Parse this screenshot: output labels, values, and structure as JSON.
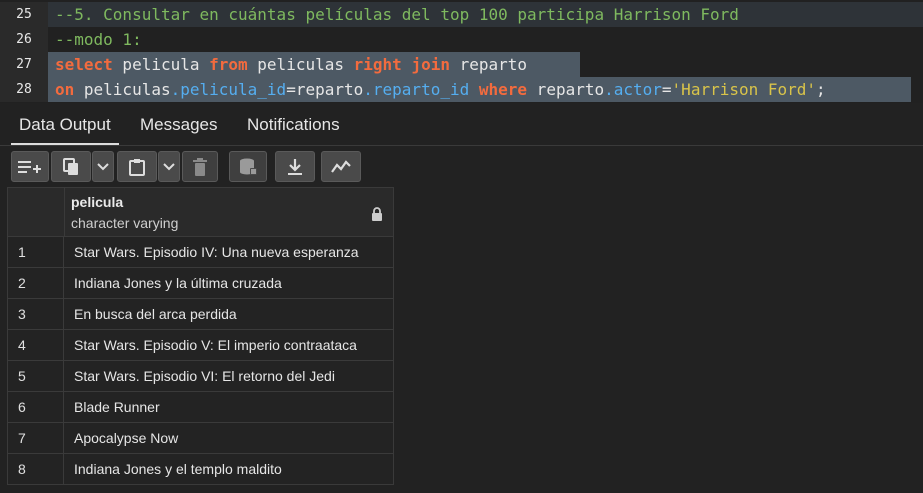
{
  "editor": {
    "lines": [
      {
        "num": "25",
        "tokens": [
          {
            "t": "--5. Consultar en cuántas películas del top 100 participa Harrison Ford",
            "c": "c-comment"
          }
        ]
      },
      {
        "num": "26",
        "tokens": [
          {
            "t": "--modo 1:",
            "c": "c-comment"
          }
        ]
      },
      {
        "num": "27",
        "tokens": [
          {
            "t": "select",
            "c": "c-kw"
          },
          {
            "t": " pelicula ",
            "c": "c-id"
          },
          {
            "t": "from",
            "c": "c-kw"
          },
          {
            "t": " peliculas ",
            "c": "c-id"
          },
          {
            "t": "right",
            "c": "c-kw"
          },
          {
            "t": " ",
            "c": "c-id"
          },
          {
            "t": "join",
            "c": "c-kw"
          },
          {
            "t": " reparto",
            "c": "c-id"
          }
        ]
      },
      {
        "num": "28",
        "tokens": [
          {
            "t": "on",
            "c": "c-kw"
          },
          {
            "t": " peliculas",
            "c": "c-id"
          },
          {
            "t": ".pelicula_id",
            "c": "c-field"
          },
          {
            "t": "=",
            "c": "c-op"
          },
          {
            "t": "reparto",
            "c": "c-id"
          },
          {
            "t": ".reparto_id",
            "c": "c-field"
          },
          {
            "t": " ",
            "c": "c-id"
          },
          {
            "t": "where",
            "c": "c-kw"
          },
          {
            "t": " reparto",
            "c": "c-id"
          },
          {
            "t": ".actor",
            "c": "c-field"
          },
          {
            "t": "=",
            "c": "c-op"
          },
          {
            "t": "'Harrison Ford'",
            "c": "c-str"
          },
          {
            "t": ";",
            "c": "c-op"
          }
        ]
      }
    ]
  },
  "tabs": {
    "data_output": "Data Output",
    "messages": "Messages",
    "notifications": "Notifications"
  },
  "toolbar": {
    "icons": [
      "add-row-icon",
      "copy-icon",
      "chevron-down-icon",
      "paste-icon",
      "chevron-down-icon",
      "delete-icon",
      "save-data-icon",
      "download-icon",
      "graph-icon"
    ]
  },
  "grid": {
    "column": {
      "name": "pelicula",
      "type": "character varying"
    },
    "rows": [
      {
        "num": "1",
        "pelicula": "Star Wars. Episodio IV: Una nueva esperanza"
      },
      {
        "num": "2",
        "pelicula": "Indiana Jones y la última cruzada"
      },
      {
        "num": "3",
        "pelicula": "En busca del arca perdida"
      },
      {
        "num": "4",
        "pelicula": "Star Wars. Episodio V: El imperio contraataca"
      },
      {
        "num": "5",
        "pelicula": "Star Wars. Episodio VI: El retorno del Jedi"
      },
      {
        "num": "6",
        "pelicula": "Blade Runner"
      },
      {
        "num": "7",
        "pelicula": "Apocalypse Now"
      },
      {
        "num": "8",
        "pelicula": "Indiana Jones y el templo maldito"
      }
    ]
  }
}
